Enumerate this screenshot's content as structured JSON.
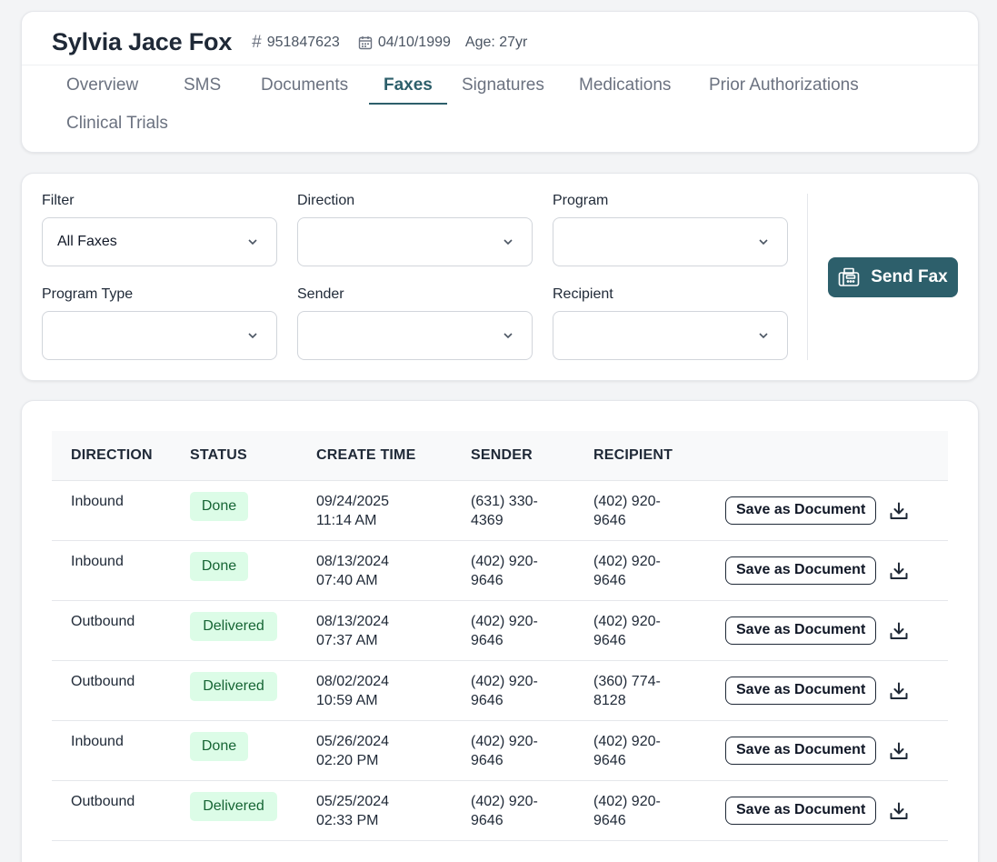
{
  "patient": {
    "name": "Sylvia Jace Fox",
    "id": "951847623",
    "dob": "04/10/1999",
    "age": "Age: 27yr"
  },
  "tabs": [
    {
      "label": "Overview",
      "active": false
    },
    {
      "label": "SMS",
      "active": false
    },
    {
      "label": "Documents",
      "active": false
    },
    {
      "label": "Faxes",
      "active": true
    },
    {
      "label": "Signatures",
      "active": false
    },
    {
      "label": "Medications",
      "active": false
    },
    {
      "label": "Prior Authorizations",
      "active": false
    },
    {
      "label": "Clinical Trials",
      "active": false
    }
  ],
  "filters": {
    "filter": {
      "label": "Filter",
      "value": "All Faxes"
    },
    "direction": {
      "label": "Direction",
      "value": ""
    },
    "program": {
      "label": "Program",
      "value": ""
    },
    "program_type": {
      "label": "Program Type",
      "value": ""
    },
    "sender": {
      "label": "Sender",
      "value": ""
    },
    "recipient": {
      "label": "Recipient",
      "value": ""
    },
    "send_fax_label": "Send Fax"
  },
  "table": {
    "headers": {
      "direction": "DIRECTION",
      "status": "STATUS",
      "create_time": "CREATE TIME",
      "sender": "SENDER",
      "recipient": "RECIPIENT"
    },
    "save_label": "Save as Document",
    "rows": [
      {
        "direction": "Inbound",
        "status": "Done",
        "date": "09/24/2025",
        "time": "11:14 AM",
        "sender_a": "(631) 330-",
        "sender_b": "4369",
        "recipient_a": "(402) 920-",
        "recipient_b": "9646"
      },
      {
        "direction": "Inbound",
        "status": "Done",
        "date": "08/13/2024",
        "time": "07:40 AM",
        "sender_a": "(402) 920-",
        "sender_b": "9646",
        "recipient_a": "(402) 920-",
        "recipient_b": "9646"
      },
      {
        "direction": "Outbound",
        "status": "Delivered",
        "date": "08/13/2024",
        "time": "07:37 AM",
        "sender_a": "(402) 920-",
        "sender_b": "9646",
        "recipient_a": "(402) 920-",
        "recipient_b": "9646"
      },
      {
        "direction": "Outbound",
        "status": "Delivered",
        "date": "08/02/2024",
        "time": "10:59 AM",
        "sender_a": "(402) 920-",
        "sender_b": "9646",
        "recipient_a": "(360) 774-",
        "recipient_b": "8128"
      },
      {
        "direction": "Inbound",
        "status": "Done",
        "date": "05/26/2024",
        "time": "02:20 PM",
        "sender_a": "(402) 920-",
        "sender_b": "9646",
        "recipient_a": "(402) 920-",
        "recipient_b": "9646"
      },
      {
        "direction": "Outbound",
        "status": "Delivered",
        "date": "05/25/2024",
        "time": "02:33 PM",
        "sender_a": "(402) 920-",
        "sender_b": "9646",
        "recipient_a": "(402) 920-",
        "recipient_b": "9646"
      }
    ]
  },
  "colors": {
    "accent": "#2d5f6b",
    "badge_bg": "#dcfce7",
    "badge_text": "#166534"
  }
}
